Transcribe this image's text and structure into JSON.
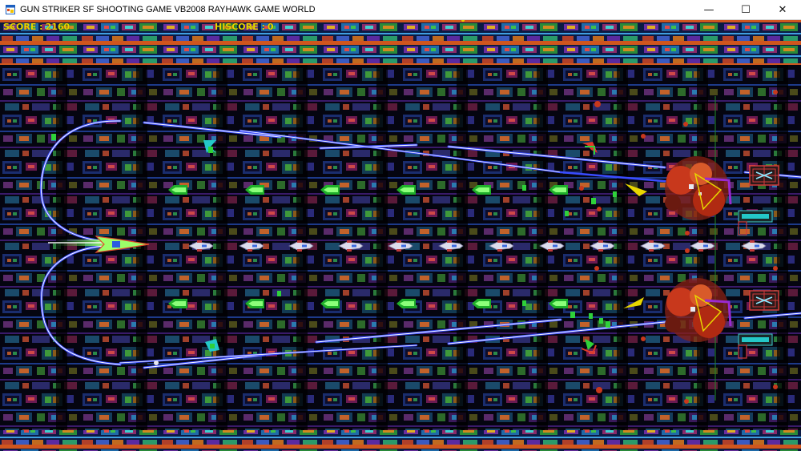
{
  "window": {
    "title": "GUN STRIKER SF SHOOTING GAME VB2008 RAYHAWK GAME WORLD",
    "minimize_glyph": "—",
    "maximize_glyph": "☐",
    "close_glyph": "✕",
    "icons": {
      "app": "app-icon"
    }
  },
  "hud": {
    "score_label": "SCORE :",
    "score_value": "2160",
    "hiscore_label": "HISCORE :",
    "hiscore_value": "0",
    "text_color": "#e8d600"
  },
  "colors": {
    "background": "#000000",
    "laser": "#3a4cff",
    "laser_core": "#ffffff",
    "player_bullet": "#2fd13a",
    "enemy": "#e8e8f0",
    "explosion": "#c8381c"
  }
}
